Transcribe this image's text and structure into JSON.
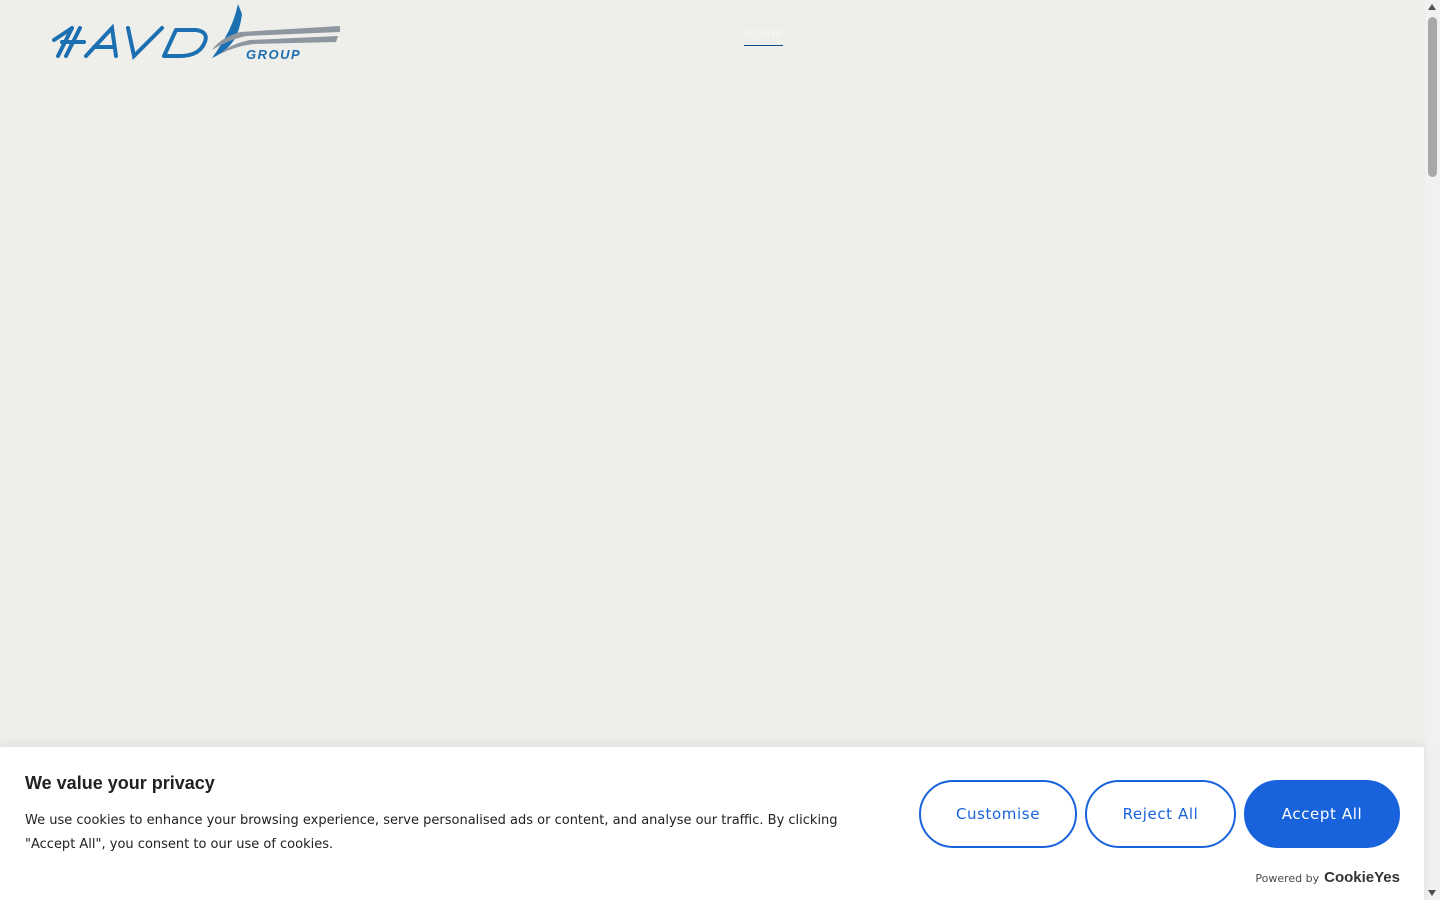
{
  "header": {
    "logo": {
      "wordmark": "HAVD",
      "subtext": "GROUP",
      "primary_color": "#1c6fb1",
      "secondary_color": "#8e96a0"
    },
    "nav": {
      "home_label": "Home"
    }
  },
  "cookie_banner": {
    "title": "We value your privacy",
    "description": "We use cookies to enhance your browsing experience, serve personalised ads or content, and analyse our traffic. By clicking \"Accept All\", you consent to our use of cookies.",
    "buttons": {
      "customise": "Customise",
      "reject": "Reject All",
      "accept": "Accept All"
    },
    "powered_by_label": "Powered by",
    "powered_by_brand": "CookieYes",
    "accent_color": "#1863dc"
  },
  "page": {
    "background_color": "#eeeeeb"
  }
}
